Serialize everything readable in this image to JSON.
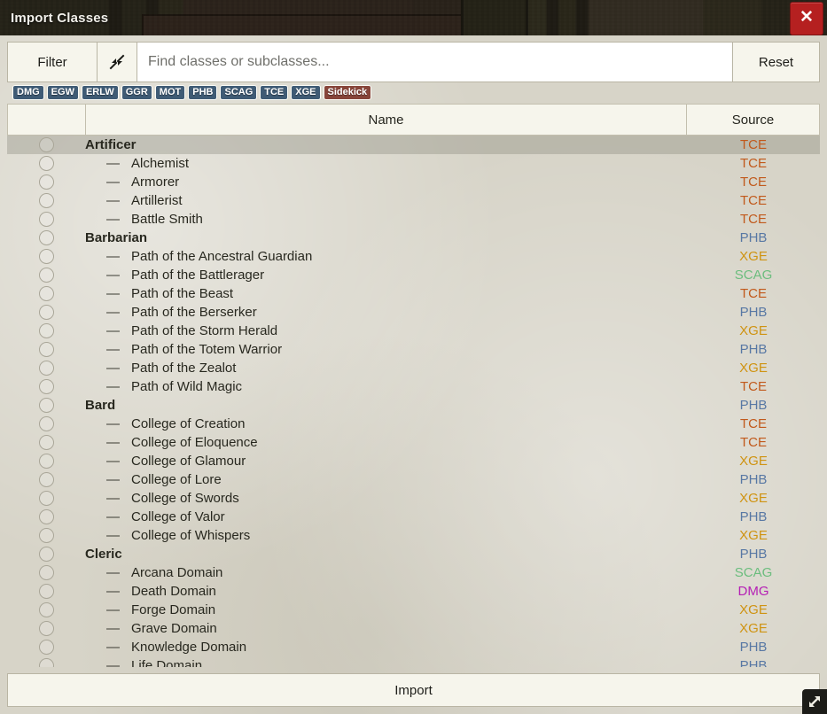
{
  "window": {
    "title": "Import Classes",
    "close_label": "✕",
    "close_icon": "close-icon",
    "resize_icon": "resize-handle-icon"
  },
  "filter_bar": {
    "filter_label": "Filter",
    "collapse_icon": "collapse-arrows-icon",
    "search_placeholder": "Find classes or subclasses...",
    "search_value": "",
    "reset_label": "Reset"
  },
  "source_pills": [
    {
      "label": "DMG",
      "style": "blue"
    },
    {
      "label": "EGW",
      "style": "blue"
    },
    {
      "label": "ERLW",
      "style": "blue"
    },
    {
      "label": "GGR",
      "style": "blue"
    },
    {
      "label": "MOT",
      "style": "blue"
    },
    {
      "label": "PHB",
      "style": "blue"
    },
    {
      "label": "SCAG",
      "style": "blue"
    },
    {
      "label": "TCE",
      "style": "blue"
    },
    {
      "label": "XGE",
      "style": "blue"
    },
    {
      "label": "Sidekick",
      "style": "brown"
    }
  ],
  "table": {
    "columns": {
      "select": "",
      "name": "Name",
      "source": "Source"
    },
    "dash": "—",
    "rows": [
      {
        "type": "group",
        "name": "Artificer",
        "source": "TCE",
        "highlighted": true
      },
      {
        "type": "sub",
        "name": "Alchemist",
        "source": "TCE"
      },
      {
        "type": "sub",
        "name": "Armorer",
        "source": "TCE"
      },
      {
        "type": "sub",
        "name": "Artillerist",
        "source": "TCE"
      },
      {
        "type": "sub",
        "name": "Battle Smith",
        "source": "TCE"
      },
      {
        "type": "group",
        "name": "Barbarian",
        "source": "PHB"
      },
      {
        "type": "sub",
        "name": "Path of the Ancestral Guardian",
        "source": "XGE"
      },
      {
        "type": "sub",
        "name": "Path of the Battlerager",
        "source": "SCAG"
      },
      {
        "type": "sub",
        "name": "Path of the Beast",
        "source": "TCE"
      },
      {
        "type": "sub",
        "name": "Path of the Berserker",
        "source": "PHB"
      },
      {
        "type": "sub",
        "name": "Path of the Storm Herald",
        "source": "XGE"
      },
      {
        "type": "sub",
        "name": "Path of the Totem Warrior",
        "source": "PHB"
      },
      {
        "type": "sub",
        "name": "Path of the Zealot",
        "source": "XGE"
      },
      {
        "type": "sub",
        "name": "Path of Wild Magic",
        "source": "TCE"
      },
      {
        "type": "group",
        "name": "Bard",
        "source": "PHB"
      },
      {
        "type": "sub",
        "name": "College of Creation",
        "source": "TCE"
      },
      {
        "type": "sub",
        "name": "College of Eloquence",
        "source": "TCE"
      },
      {
        "type": "sub",
        "name": "College of Glamour",
        "source": "XGE"
      },
      {
        "type": "sub",
        "name": "College of Lore",
        "source": "PHB"
      },
      {
        "type": "sub",
        "name": "College of Swords",
        "source": "XGE"
      },
      {
        "type": "sub",
        "name": "College of Valor",
        "source": "PHB"
      },
      {
        "type": "sub",
        "name": "College of Whispers",
        "source": "XGE"
      },
      {
        "type": "group",
        "name": "Cleric",
        "source": "PHB"
      },
      {
        "type": "sub",
        "name": "Arcana Domain",
        "source": "SCAG"
      },
      {
        "type": "sub",
        "name": "Death Domain",
        "source": "DMG"
      },
      {
        "type": "sub",
        "name": "Forge Domain",
        "source": "XGE"
      },
      {
        "type": "sub",
        "name": "Grave Domain",
        "source": "XGE"
      },
      {
        "type": "sub",
        "name": "Knowledge Domain",
        "source": "PHB"
      },
      {
        "type": "sub",
        "name": "Life Domain",
        "source": "PHB"
      }
    ]
  },
  "footer": {
    "import_label": "Import"
  },
  "colors": {
    "source_TCE": "#c1591b",
    "source_PHB": "#5878a4",
    "source_XGE": "#cf9311",
    "source_SCAG": "#6cbd7e",
    "source_DMG": "#b51fb5",
    "pill_blue": "#3f5b75",
    "pill_brown": "#87453a",
    "scrollbar_thumb": "#e2580f",
    "close_button": "#b52020",
    "body_background": "#d7d4c8"
  }
}
